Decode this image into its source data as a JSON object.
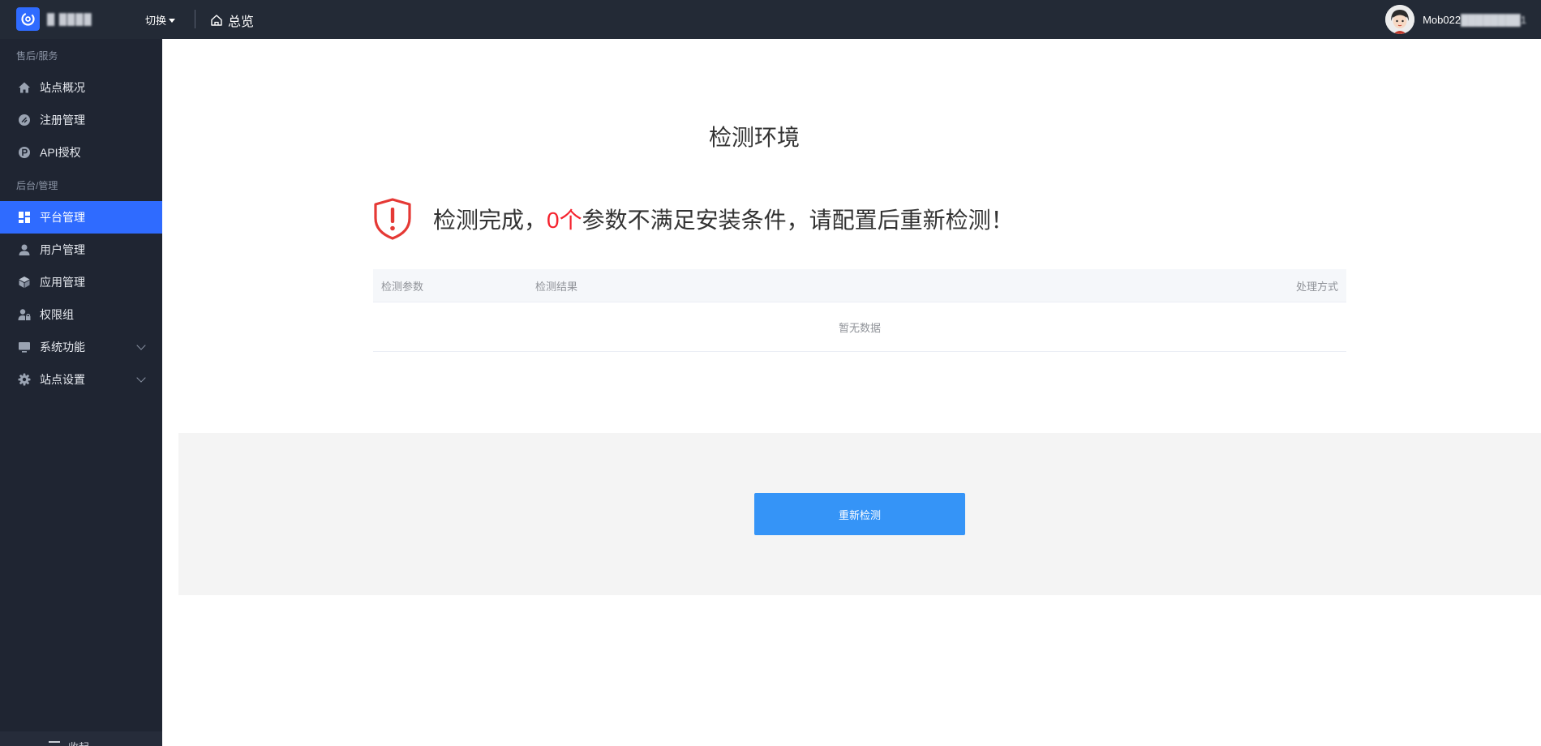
{
  "topbar": {
    "site_name": "█ ████",
    "switch_label": "切换",
    "overview_label": "总览",
    "user_prefix": "Mob022",
    "user_masked": "████████1"
  },
  "sidebar": {
    "groups": [
      {
        "title": "售后/服务",
        "items": [
          {
            "label": "站点概况",
            "icon": "home-icon"
          },
          {
            "label": "注册管理",
            "icon": "register-icon"
          },
          {
            "label": "API授权",
            "icon": "api-icon"
          }
        ]
      },
      {
        "title": "后台/管理",
        "items": [
          {
            "label": "平台管理",
            "icon": "grid-icon",
            "active": true
          },
          {
            "label": "用户管理",
            "icon": "user-icon"
          },
          {
            "label": "应用管理",
            "icon": "cube-icon"
          },
          {
            "label": "权限组",
            "icon": "user-lock-icon"
          },
          {
            "label": "系统功能",
            "icon": "monitor-icon",
            "expandable": true
          },
          {
            "label": "站点设置",
            "icon": "gear-icon",
            "expandable": true
          }
        ]
      }
    ],
    "collapse_label": "收起"
  },
  "main": {
    "title": "检测环境",
    "alert": {
      "prefix": "检测完成，",
      "count": "0个",
      "suffix": "参数不满足安装条件，请配置后重新检测！",
      "icon": "shield-warning-icon",
      "color": "#e53935"
    },
    "table": {
      "columns": [
        "检测参数",
        "检测结果",
        "处理方式"
      ],
      "empty_text": "暂无数据"
    },
    "recheck_button": "重新检测"
  },
  "colors": {
    "topbar": "#232a36",
    "sidebar": "#1f2532",
    "accent": "#2f6bff",
    "button": "#3594f7",
    "danger": "#f5222d"
  }
}
